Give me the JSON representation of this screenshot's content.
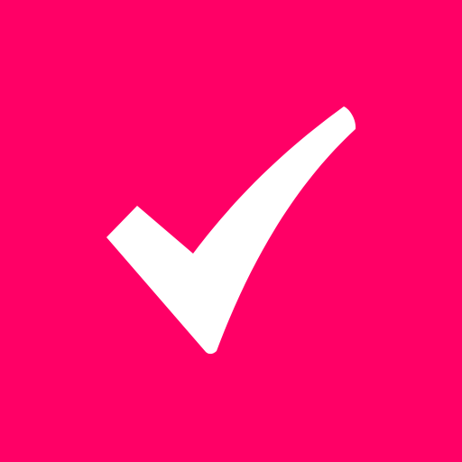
{
  "icon": {
    "name": "checkmark-icon",
    "background_color": "#FF0066",
    "foreground_color": "#FFFFFF"
  }
}
